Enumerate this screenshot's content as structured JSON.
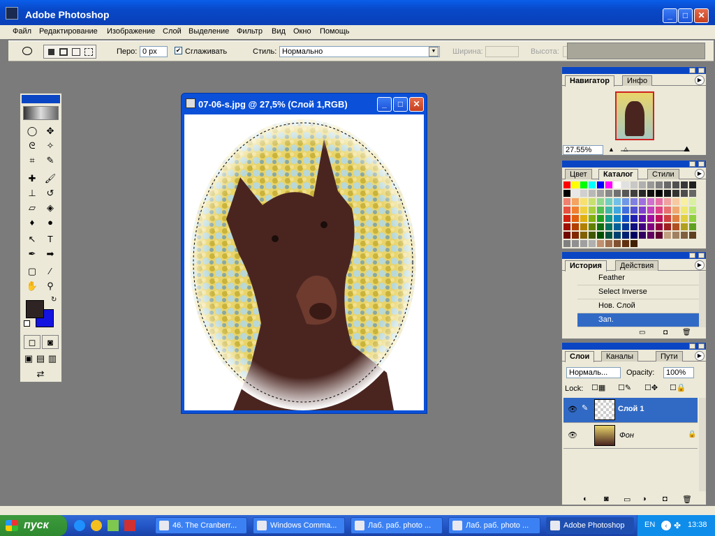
{
  "window": {
    "title": "Adobe Photoshop"
  },
  "menu": [
    "Файл",
    "Редактирование",
    "Изображение",
    "Слой",
    "Выделение",
    "Фильтр",
    "Вид",
    "Окно",
    "Помощь"
  ],
  "options": {
    "feather_label": "Перо:",
    "feather_value": "0 px",
    "antialias_label": "Сглаживать",
    "style_label": "Стиль:",
    "style_value": "Нормально",
    "width_label": "Ширина:",
    "height_label": "Высота:"
  },
  "document": {
    "title": "07-06-s.jpg @ 27,5% (Слой 1,RGB)"
  },
  "navigator": {
    "tabs": [
      "Навигатор",
      "Инфо"
    ],
    "zoom": "27.55%"
  },
  "swatches_panel": {
    "tabs": [
      "Цвет",
      "Каталог",
      "Стили"
    ]
  },
  "history": {
    "tabs": [
      "История",
      "Действия"
    ],
    "items": [
      "Feather",
      "Select Inverse",
      "Нов. Слой",
      "Зап."
    ]
  },
  "layers": {
    "tabs": [
      "Слои",
      "Каналы",
      "Пути"
    ],
    "blend_mode": "Нормаль...",
    "opacity_label": "Opacity:",
    "opacity_value": "100%",
    "lock_label": "Lock:",
    "items": [
      "Слой 1",
      "Фон"
    ]
  },
  "colors": {
    "foreground": "#2e2424",
    "background": "#1414e0",
    "accent": "#0a50d8"
  },
  "taskbar": {
    "start": "пуск",
    "tasks": [
      "46. The Cranberr...",
      "Windows Comma...",
      "Лаб. раб. photo ...",
      "Лаб. раб. photo ...",
      "Adobe Photoshop"
    ],
    "lang": "EN",
    "clock": "13:38"
  }
}
